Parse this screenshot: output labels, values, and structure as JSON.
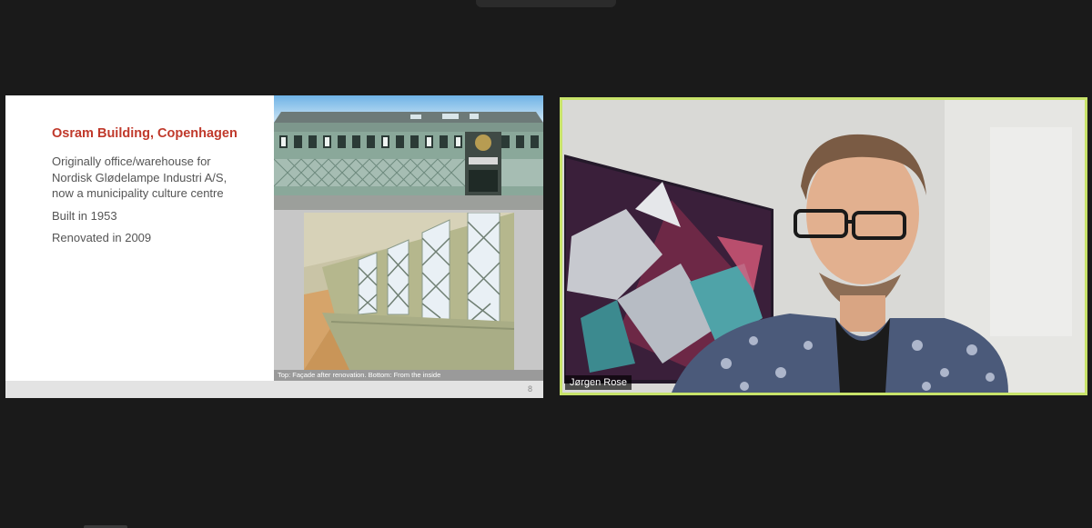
{
  "slide": {
    "title": "Osram Building, Copenhagen",
    "description_lines": [
      "Originally office/warehouse for",
      "Nordisk Glødelampe Industri A/S,",
      "now a municipality culture centre"
    ],
    "built": "Built in 1953",
    "renovated": "Renovated in 2009",
    "caption": "Top: Façade after renovation. Bottom: From the inside",
    "page_number": "8",
    "colors": {
      "title": "#c0392b",
      "body_text": "#555555"
    }
  },
  "video": {
    "participant_name": "Jørgen Rose",
    "active_speaker_border": "#c8e36a"
  }
}
